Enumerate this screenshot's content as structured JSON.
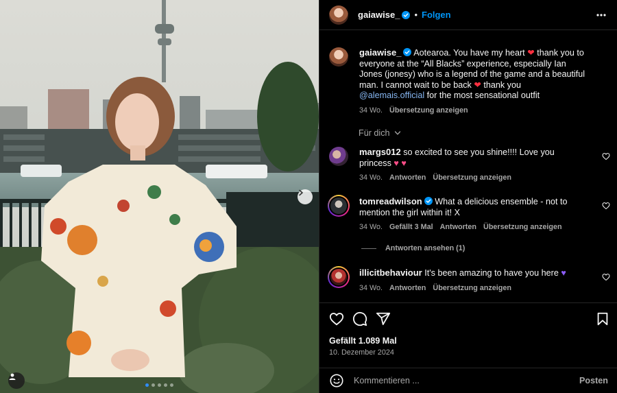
{
  "header": {
    "username": "gaiawise_",
    "follow_label": "Folgen",
    "bullet": "•"
  },
  "caption": {
    "username": "gaiawise_",
    "text_1": "Aotearoa. You have my heart",
    "text_2": "thank you to everyone at the “All Blacks” experience, especially Ian Jones (jonesy) who is a legend of the game and a beautiful man. I cannot wait to be back",
    "text_3": "thank you",
    "mention": "@alemais.official",
    "text_4": "for the most sensational outfit",
    "age": "34 Wo.",
    "translate": "Übersetzung anzeigen"
  },
  "for_you_label": "Für dich",
  "comments": [
    {
      "username": "margs012",
      "text": "so excited to see you shine!!!! Love you princess",
      "age": "34 Wo.",
      "reply": "Antworten",
      "translate": "Übersetzung anzeigen"
    },
    {
      "username": "tomreadwilson",
      "text": "What a delicious ensemble - not to mention the girl within it! X",
      "age": "34 Wo.",
      "likes": "Gefällt 3 Mal",
      "reply": "Antworten",
      "translate": "Übersetzung anzeigen",
      "view_replies": "Antworten ansehen (1)"
    },
    {
      "username": "illicitbehaviour",
      "text": "It's been amazing to have you here",
      "age": "34 Wo.",
      "reply": "Antworten",
      "translate": "Übersetzung anzeigen"
    }
  ],
  "post": {
    "likes": "Gefällt 1.089 Mal",
    "date": "10. Dezember 2024"
  },
  "compose": {
    "placeholder": "Kommentieren ...",
    "post_label": "Posten"
  },
  "icons": {
    "more": "more-horizontal-icon",
    "heart": "heart-icon",
    "comment": "comment-icon",
    "share": "share-icon",
    "save": "bookmark-icon",
    "emoji": "emoji-icon",
    "next": "chevron-right-icon",
    "tag": "user-tag-icon",
    "verified": "verified-badge-icon"
  },
  "colors": {
    "background": "#000000",
    "accent": "#0095f6",
    "muted": "#a8a8a8",
    "heart": "#ff3040"
  },
  "carousel": {
    "slides": 5,
    "active": 1
  }
}
